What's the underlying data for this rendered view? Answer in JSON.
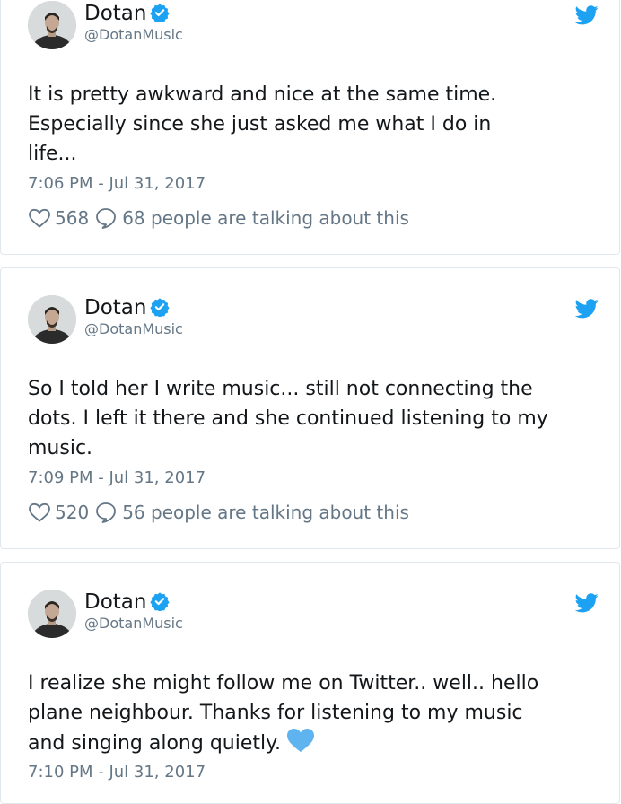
{
  "tweets": [
    {
      "author": {
        "name": "Dotan",
        "handle": "@DotanMusic"
      },
      "lines": [
        "It is pretty awkward and nice at the same time.",
        "Especially since she just  asked me what I do in",
        "life..."
      ],
      "timestamp": "7:06 PM - Jul 31, 2017",
      "likes": "568",
      "replies": "68 people are talking about this"
    },
    {
      "author": {
        "name": "Dotan",
        "handle": "@DotanMusic"
      },
      "lines": [
        "So I told her I write music... still not connecting the",
        "dots. I left it there and she continued listening to my",
        "music."
      ],
      "timestamp": "7:09 PM - Jul 31, 2017",
      "likes": "520",
      "replies": "56 people are talking about this"
    },
    {
      "author": {
        "name": "Dotan",
        "handle": "@DotanMusic"
      },
      "lines": [
        "I realize she might follow me on Twitter.. well.. hello",
        "plane neighbour. Thanks for listening to my music",
        "and singing along quietly."
      ],
      "emoji": "blue-heart-icon",
      "timestamp": "7:10 PM - Jul 31, 2017"
    }
  ],
  "colors": {
    "text": "#14171a",
    "secondary": "#657786",
    "twitter_blue": "#1da1f2",
    "verified": "#1da1f2",
    "border": "#e1e8ed",
    "emoji_heart": "#5fb4f0"
  }
}
